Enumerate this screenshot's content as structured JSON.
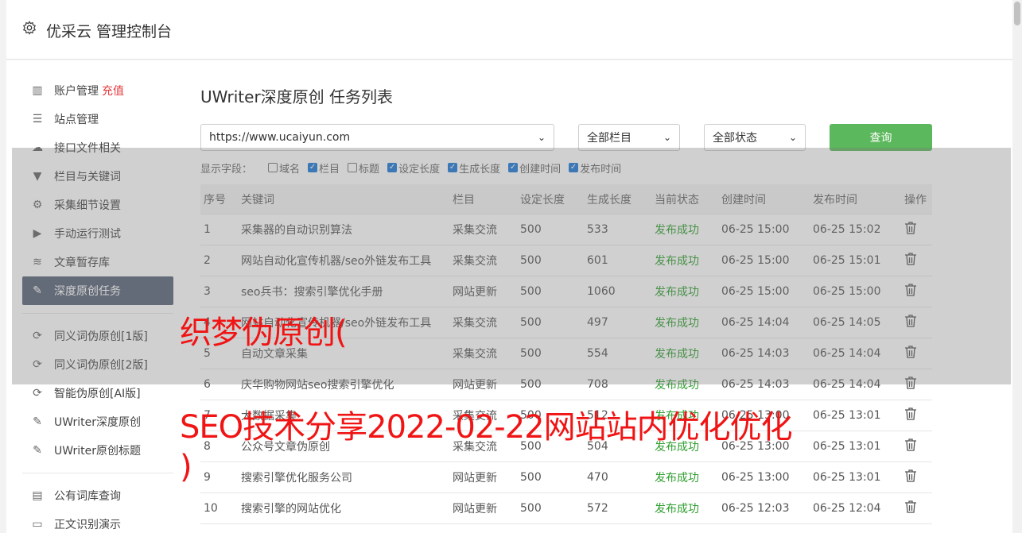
{
  "header": {
    "title": "优采云 管理控制台"
  },
  "sidebar": {
    "items": [
      {
        "icon": "bar-chart-icon",
        "glyph": "▥",
        "label": "账户管理",
        "badge": "充值"
      },
      {
        "icon": "server-icon",
        "glyph": "☰",
        "label": "站点管理"
      },
      {
        "icon": "cloud-upload-icon",
        "glyph": "☁",
        "label": "接口文件相关"
      },
      {
        "icon": "filter-icon",
        "glyph": "▼",
        "label": "栏目与关键词"
      },
      {
        "icon": "gears-icon",
        "glyph": "⚙",
        "label": "采集细节设置"
      },
      {
        "icon": "play-circle-icon",
        "glyph": "▶",
        "label": "手动运行测试"
      },
      {
        "icon": "database-icon",
        "glyph": "≋",
        "label": "文章暂存库"
      },
      {
        "icon": "edit-icon",
        "glyph": "✎",
        "label": "深度原创任务",
        "active": true
      }
    ],
    "items2": [
      {
        "icon": "refresh-icon",
        "glyph": "⟳",
        "label": "同义词伪原创[1版]"
      },
      {
        "icon": "refresh-icon",
        "glyph": "⟳",
        "label": "同义词伪原创[2版]"
      },
      {
        "icon": "refresh-icon",
        "glyph": "⟳",
        "label": "智能伪原创[AI版]"
      },
      {
        "icon": "edit-icon",
        "glyph": "✎",
        "label": "UWriter深度原创"
      },
      {
        "icon": "edit-icon",
        "glyph": "✎",
        "label": "UWriter原创标题"
      }
    ],
    "items3": [
      {
        "icon": "book-icon",
        "glyph": "▤",
        "label": "公有词库查询"
      },
      {
        "icon": "monitor-icon",
        "glyph": "▭",
        "label": "正文识别演示"
      }
    ]
  },
  "main": {
    "title": "UWriter深度原创 任务列表",
    "filters": {
      "site": "https://www.ucaiyun.com",
      "column": "全部栏目",
      "status": "全部状态",
      "query_label": "查询"
    },
    "fields_label": "显示字段：",
    "fields": [
      {
        "label": "域名",
        "checked": false
      },
      {
        "label": "栏目",
        "checked": true
      },
      {
        "label": "标题",
        "checked": false
      },
      {
        "label": "设定长度",
        "checked": true
      },
      {
        "label": "生成长度",
        "checked": true
      },
      {
        "label": "创建时间",
        "checked": true
      },
      {
        "label": "发布时间",
        "checked": true
      }
    ],
    "columns": [
      "序号",
      "关键词",
      "栏目",
      "设定长度",
      "生成长度",
      "当前状态",
      "创建时间",
      "发布时间",
      "操作"
    ],
    "rows": [
      [
        "1",
        "采集器的自动识别算法",
        "采集交流",
        "500",
        "533",
        "发布成功",
        "06-25 15:00",
        "06-25 15:02"
      ],
      [
        "2",
        "网站自动化宣传机器/seo外链发布工具",
        "采集交流",
        "500",
        "601",
        "发布成功",
        "06-25 15:00",
        "06-25 15:01"
      ],
      [
        "3",
        "seo兵书：搜索引擎优化手册",
        "网站更新",
        "500",
        "1060",
        "发布成功",
        "06-25 15:00",
        "06-25 15:00"
      ],
      [
        "4",
        "网站自动化宣传机器/seo外链发布工具",
        "采集交流",
        "500",
        "497",
        "发布成功",
        "06-25 14:04",
        "06-25 14:05"
      ],
      [
        "5",
        "自动文章采集",
        "采集交流",
        "500",
        "554",
        "发布成功",
        "06-25 14:03",
        "06-25 14:04"
      ],
      [
        "6",
        "庆华购物网站seo搜索引擎优化",
        "网站更新",
        "500",
        "708",
        "发布成功",
        "06-25 14:03",
        "06-25 14:04"
      ],
      [
        "7",
        "大数据采集",
        "采集交流",
        "500",
        "512",
        "发布成功",
        "06-25 13:00",
        "06-25 13:01"
      ],
      [
        "8",
        "公众号文章伪原创",
        "采集交流",
        "500",
        "504",
        "发布成功",
        "06-25 13:00",
        "06-25 13:01"
      ],
      [
        "9",
        "搜索引擎优化服务公司",
        "网站更新",
        "500",
        "470",
        "发布成功",
        "06-25 13:00",
        "06-25 13:01"
      ],
      [
        "10",
        "搜索引擎的网站优化",
        "网站更新",
        "500",
        "572",
        "发布成功",
        "06-25 12:03",
        "06-25 12:04"
      ]
    ]
  },
  "watermark": {
    "line1": "织梦伪原创(",
    "line2": "SEO技术分享2022-02-22网站站内优化优化",
    "line3": ")"
  },
  "colors": {
    "accent_green": "#5cb85c",
    "status_green": "#2e9e2e",
    "badge_red": "#e4393c",
    "active_nav": "#5a6578",
    "watermark": "#f01414"
  }
}
